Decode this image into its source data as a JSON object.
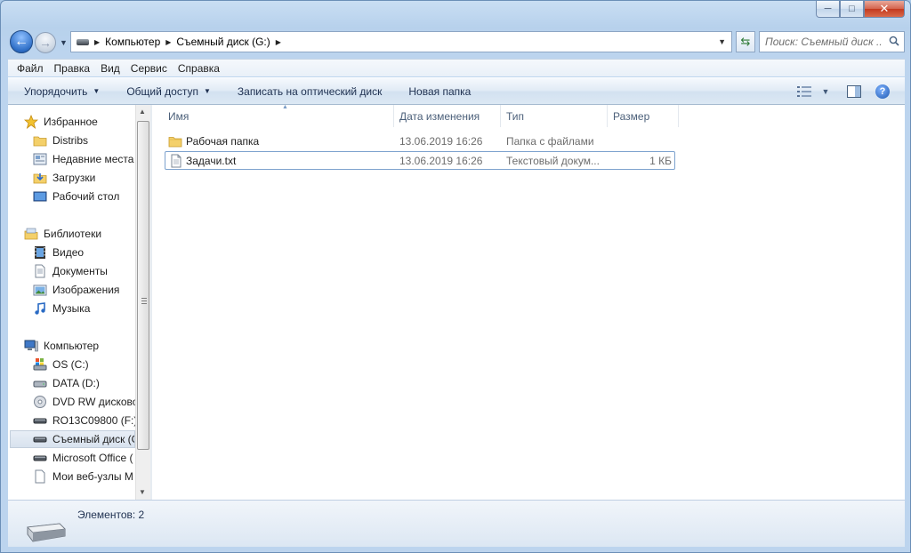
{
  "window": {
    "min_symbol": "─",
    "max_symbol": "□",
    "close_symbol": "✕"
  },
  "nav": {
    "back_symbol": "←",
    "forward_symbol": "→"
  },
  "address": {
    "crumbs": [
      "Компьютер",
      "Съемный диск (G:)"
    ]
  },
  "search": {
    "placeholder": "Поиск: Съемный диск ..."
  },
  "menu": {
    "items": [
      "Файл",
      "Правка",
      "Вид",
      "Сервис",
      "Справка"
    ]
  },
  "toolbar": {
    "organize": "Упорядочить",
    "share": "Общий доступ",
    "burn": "Записать на оптический диск",
    "new_folder": "Новая папка"
  },
  "sidebar": {
    "favorites": "Избранное",
    "favorites_items": [
      "Distribs",
      "Недавние места",
      "Загрузки",
      "Рабочий стол"
    ],
    "libraries": "Библиотеки",
    "libraries_items": [
      "Видео",
      "Документы",
      "Изображения",
      "Музыка"
    ],
    "computer": "Компьютер",
    "computer_items": [
      "OS (C:)",
      "DATA (D:)",
      "DVD RW дисково",
      "RO13C09800 (F:)",
      "Съемный диск (G",
      "Microsoft Office (",
      "Мои веб-узлы M"
    ]
  },
  "columns": {
    "name": "Имя",
    "date": "Дата изменения",
    "type": "Тип",
    "size": "Размер"
  },
  "files": [
    {
      "name": "Рабочая папка",
      "date": "13.06.2019 16:26",
      "type": "Папка с файлами",
      "size": ""
    },
    {
      "name": "Задачи.txt",
      "date": "13.06.2019 16:26",
      "type": "Текстовый докум...",
      "size": "1 КБ"
    }
  ],
  "status": {
    "count": "Элементов: 2"
  }
}
